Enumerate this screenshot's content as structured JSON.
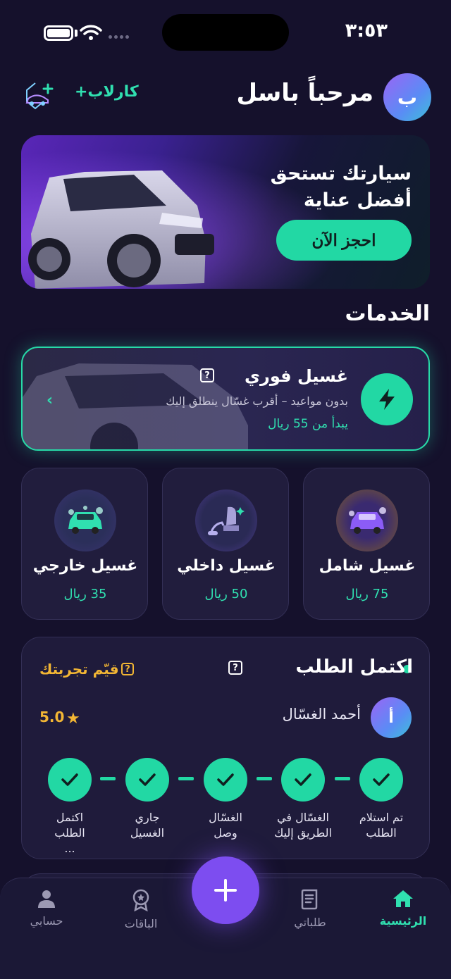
{
  "status_bar": {
    "time": "٣:٥٣"
  },
  "header": {
    "avatar_letter": "ب",
    "greeting": "مرحباً باسل",
    "brand": "كارلاب+"
  },
  "hero": {
    "title": "سيارتك تستحق أفضل عناية",
    "cta": "احجز الآن"
  },
  "services": {
    "section_title": "الخدمات",
    "instant": {
      "title": "غسيل فوري",
      "help": "?",
      "subtitle": "بدون مواعيد – أقرب غسّال ينطلق إليك",
      "price": "يبدأ من 55 ريال"
    },
    "tiles": [
      {
        "title": "غسيل شامل",
        "price": "75 ريال",
        "icon": "full-wash-car-icon"
      },
      {
        "title": "غسيل داخلي",
        "price": "50 ريال",
        "icon": "interior-vacuum-seat-icon"
      },
      {
        "title": "غسيل خارجي",
        "price": "35 ريال",
        "icon": "exterior-wash-car-icon"
      }
    ]
  },
  "order": {
    "title": "اكتمل الطلب",
    "help": "?",
    "rate_label": "قيّم تجربتك",
    "rate_help": "?",
    "washer_initial": "أ",
    "washer_name": "أحمد الغسّال",
    "rating": "5.0",
    "steps": [
      {
        "label": "تم استلام الطلب"
      },
      {
        "label": "الغسّال في الطريق إليك"
      },
      {
        "label": "الغسّال وصل"
      },
      {
        "label": "جاري الغسيل"
      },
      {
        "label": "اكتمل الطلب ..."
      }
    ]
  },
  "nav": {
    "items": [
      {
        "label": "الرئيسية",
        "icon": "home-icon",
        "active": true
      },
      {
        "label": "طلباتي",
        "icon": "receipt-icon",
        "active": false
      },
      {
        "label": "الباقات",
        "icon": "badge-icon",
        "active": false
      },
      {
        "label": "حسابي",
        "icon": "user-icon",
        "active": false
      }
    ]
  },
  "colors": {
    "background": "#15112c",
    "accent": "#22d8a4",
    "primary": "#7d4df0",
    "gold": "#f2b634"
  }
}
